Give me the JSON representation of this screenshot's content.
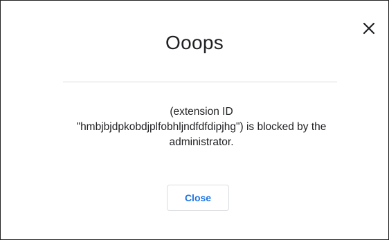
{
  "dialog": {
    "title": "Ooops",
    "message_lines": [
      "(extension ID",
      "\"hmbjbjdpkobdjplfobhljndfdfdipjhg\") is blocked by the",
      "administrator."
    ],
    "close_button_label": "Close",
    "close_icon": "close-icon",
    "colors": {
      "accent": "#1a73e8",
      "text": "#202124",
      "divider": "#dadce0"
    }
  }
}
